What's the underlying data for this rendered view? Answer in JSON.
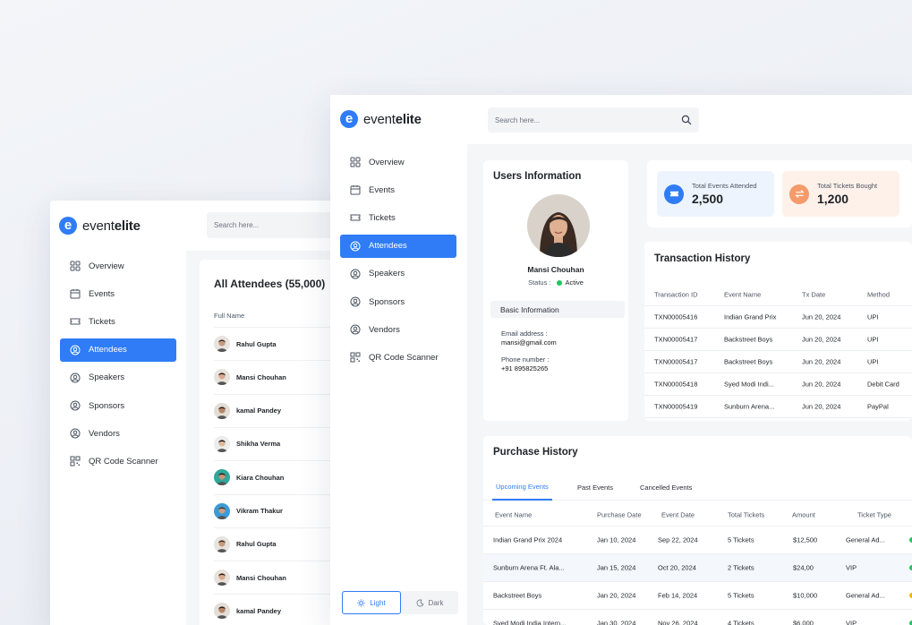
{
  "brand": {
    "name_light": "event",
    "name_bold": "elite",
    "mark": "e",
    "accent": "#2f7cf6"
  },
  "search": {
    "placeholder": "Search here..."
  },
  "sidebar": {
    "items": [
      {
        "label": "Overview",
        "icon": "grid-icon"
      },
      {
        "label": "Events",
        "icon": "calendar-icon"
      },
      {
        "label": "Tickets",
        "icon": "ticket-icon"
      },
      {
        "label": "Attendees",
        "icon": "user-icon"
      },
      {
        "label": "Speakers",
        "icon": "user-icon"
      },
      {
        "label": "Sponsors",
        "icon": "user-icon"
      },
      {
        "label": "Vendors",
        "icon": "user-icon"
      },
      {
        "label": "QR Code Scanner",
        "icon": "qr-icon"
      }
    ],
    "active": "Attendees"
  },
  "theme": {
    "light": "Light",
    "dark": "Dark"
  },
  "attendees": {
    "title": "All Attendees (55,000)",
    "column": "Full Name",
    "rows": [
      {
        "name": "Rahul Gupta",
        "skin": "#c89a7c",
        "hair": "#3b2a20",
        "bg": "#e7e3de"
      },
      {
        "name": "Mansi Chouhan",
        "skin": "#d9a98a",
        "hair": "#2a1d17",
        "bg": "#e8e2dc"
      },
      {
        "name": "kamal Pandey",
        "skin": "#b98565",
        "hair": "#2b201a",
        "bg": "#e2ddd6"
      },
      {
        "name": "Shikha Verma",
        "skin": "#e0b89d",
        "hair": "#1c1410",
        "bg": "#ececec"
      },
      {
        "name": "Kiara Chouhan",
        "skin": "#c99377",
        "hair": "#2a1b12",
        "bg": "#2fa79a"
      },
      {
        "name": "Vikram Thakur",
        "skin": "#caa086",
        "hair": "#4a3326",
        "bg": "#3b9bd6"
      },
      {
        "name": "Rahul Gupta",
        "skin": "#c89a7c",
        "hair": "#3b2a20",
        "bg": "#e7e3de"
      },
      {
        "name": "Mansi Chouhan",
        "skin": "#d9a98a",
        "hair": "#2a1d17",
        "bg": "#e8e2dc"
      },
      {
        "name": "kamal Pandey",
        "skin": "#b98565",
        "hair": "#2b201a",
        "bg": "#e2ddd6"
      }
    ]
  },
  "user": {
    "title": "Users Information",
    "name": "Mansi Chouhan",
    "status_label": "Status :",
    "status": "Active",
    "section": "Basic Information",
    "email_label": "Email address :",
    "email": "mansi@gmail.com",
    "phone_label": "Phone number :",
    "phone": "+91 895825265"
  },
  "stats": [
    {
      "label": "Total Events Attended",
      "value": "2,500",
      "icon": "ticket-icon",
      "color": "#2f7cf6",
      "bg": "#eef4fd"
    },
    {
      "label": "Total Tickets Bought",
      "value": "1,200",
      "icon": "swap-icon",
      "color": "#f59a6b",
      "bg": "#fdf1ea"
    }
  ],
  "transactions": {
    "title": "Transaction History",
    "columns": [
      "Transaction ID",
      "Event Name",
      "Tx Date",
      "Method"
    ],
    "rows": [
      [
        "TXN00005416",
        "Indian Grand Prix",
        "Jun 20, 2024",
        "UPI"
      ],
      [
        "TXN00005417",
        "Backstreet Boys",
        "Jun 20, 2024",
        "UPI"
      ],
      [
        "TXN00005417",
        "Backstreet Boys",
        "Jun 20, 2024",
        "UPI"
      ],
      [
        "TXN00005418",
        "Syed Modi Indi...",
        "Jun 20, 2024",
        "Debit Card"
      ],
      [
        "TXN00005419",
        "Sunburn Arena...",
        "Jun 20, 2024",
        "PayPal"
      ]
    ]
  },
  "purchases": {
    "title": "Purchase History",
    "tabs": [
      "Upcoming Events",
      "Past Events",
      "Cancelled Events"
    ],
    "active_tab": "Upcoming Events",
    "columns": [
      "Event Name",
      "Purchase Date",
      "Event Date",
      "Total Tickets",
      "Amount",
      "Ticket Type"
    ],
    "rows": [
      [
        "Indian Grand Prix 2024",
        "Jan 10, 2024",
        "Sep 22, 2024",
        "5 Tickets",
        "$12,500",
        "General Ad..."
      ],
      [
        "Sunburn Arena Ft. Ala...",
        "Jan 15, 2024",
        "Oct 20, 2024",
        "2 Tickets",
        "$24,00",
        "VIP"
      ],
      [
        "Backstreet Boys",
        "Jan 20, 2024",
        "Feb 14, 2024",
        "5 Tickets",
        "$10,000",
        "General Ad..."
      ],
      [
        "Syed Modi India Intern...",
        "Jan 30, 2024",
        "Nov 26, 2024",
        "4 Tickets",
        "$6,000",
        "VIP"
      ]
    ],
    "row_status_colors": [
      "#22c55e",
      "#22c55e",
      "#f5b400",
      "#22c55e"
    ]
  }
}
